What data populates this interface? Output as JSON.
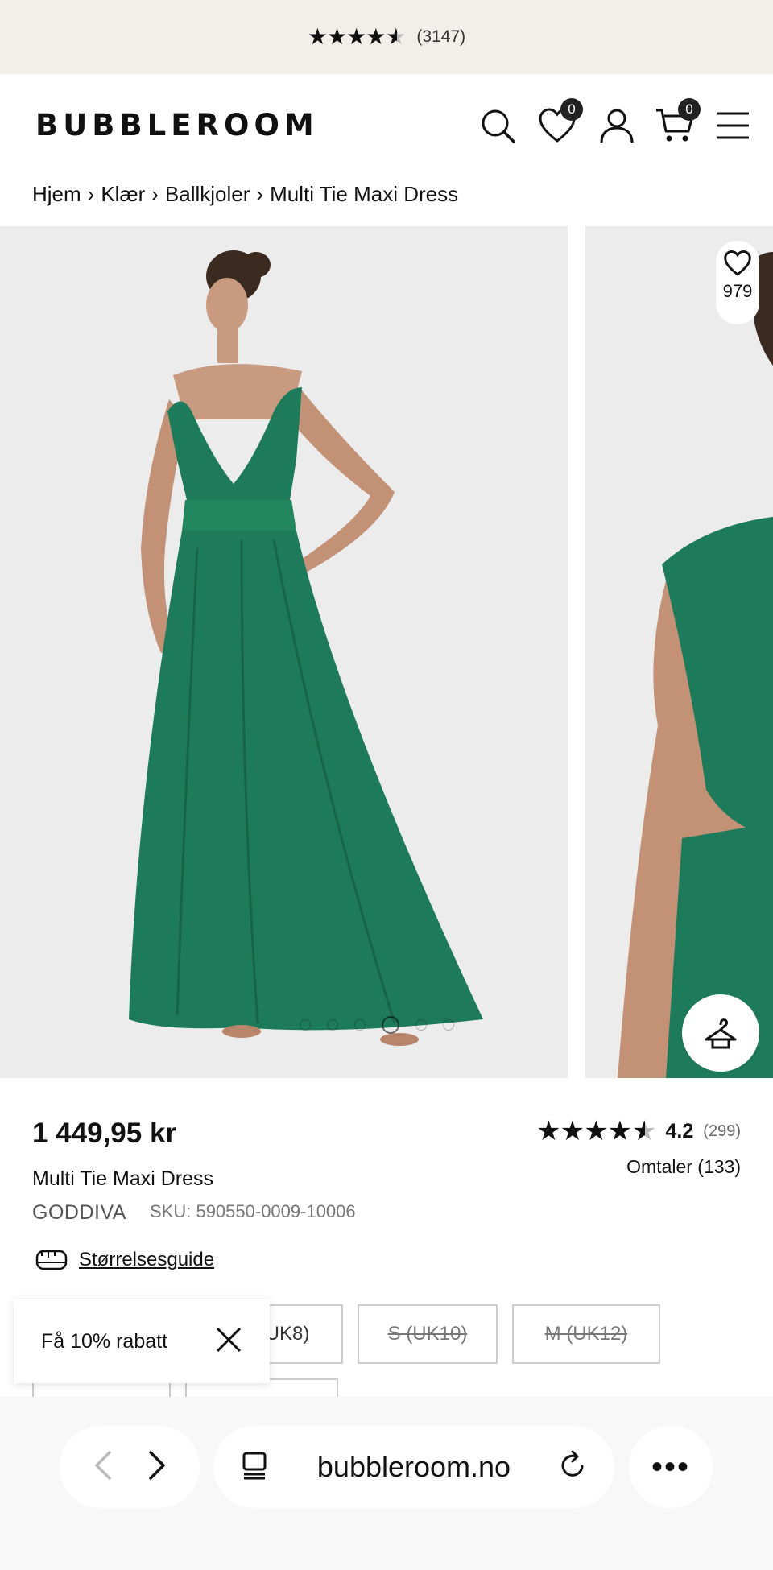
{
  "topbar": {
    "rating_stars": "4.5",
    "count": "(3147)"
  },
  "header": {
    "logo": "BUBBLEROOM",
    "wishlist_count": "0",
    "cart_count": "0"
  },
  "breadcrumb": [
    "Hjem",
    "Klær",
    "Ballkjoler",
    "Multi Tie Maxi Dress"
  ],
  "breadcrumb_sep": "›",
  "gallery": {
    "wishlist_count": "979",
    "active_dot": 4,
    "dots": 6,
    "dress_color": "#1d7a5a"
  },
  "product": {
    "price": "1 449,95 kr",
    "name": "Multi Tie Maxi Dress",
    "brand": "GODDIVA",
    "sku": "SKU: 590550-0009-10006",
    "rating_value": "4.2",
    "rating_count": "(299)",
    "reviews": "Omtaler (133)",
    "size_guide": "Størrelsesguide"
  },
  "sizes": [
    {
      "label": "UK8)",
      "available": true
    },
    {
      "label": "S (UK10)",
      "available": false
    },
    {
      "label": "M (UK12)",
      "available": false
    }
  ],
  "promo": {
    "text": "Få 10% rabatt"
  },
  "browser": {
    "url": "bubbleroom.no",
    "more": "•••"
  }
}
